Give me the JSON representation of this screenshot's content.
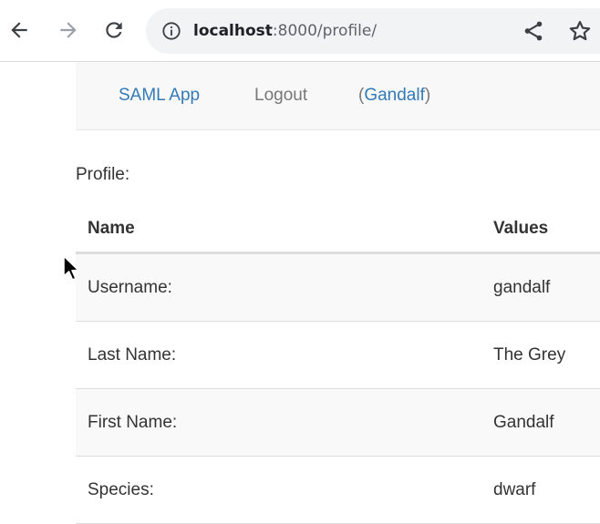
{
  "browser": {
    "url_host": "localhost",
    "url_rest": ":8000/profile/",
    "icons": [
      "back-arrow-icon",
      "forward-arrow-icon",
      "reload-icon",
      "info-icon",
      "share-icon",
      "star-icon"
    ]
  },
  "navbar": {
    "brand": "SAML App",
    "logout": "Logout",
    "user_open": "(",
    "user_name": "Gandalf",
    "user_close": ")"
  },
  "page": {
    "profile_label": "Profile:"
  },
  "table": {
    "headers": [
      "Name",
      "Values"
    ],
    "rows": [
      {
        "name": "Username:",
        "value": "gandalf"
      },
      {
        "name": "Last Name:",
        "value": "The Grey"
      },
      {
        "name": "First Name:",
        "value": "Gandalf"
      },
      {
        "name": "Species:",
        "value": "dwarf"
      }
    ]
  },
  "colors": {
    "link": "#337ab7",
    "nav_text": "#777777",
    "navbar_bg": "#f8f8f8",
    "stripe_bg": "#f9f9f9"
  }
}
